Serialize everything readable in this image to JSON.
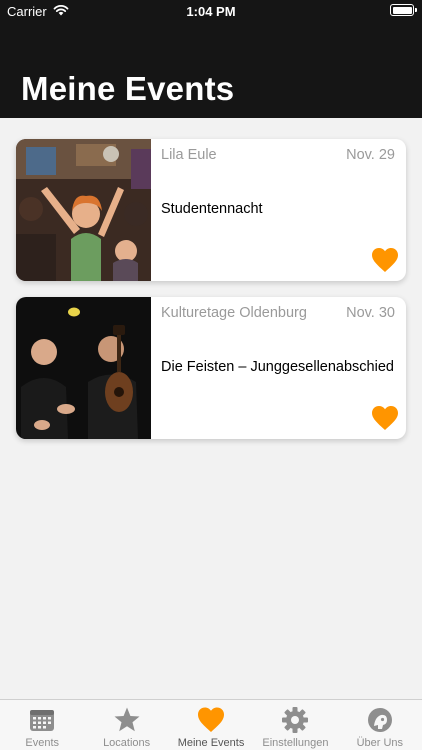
{
  "status_bar": {
    "carrier": "Carrier",
    "time": "1:04 PM"
  },
  "header": {
    "title": "Meine Events"
  },
  "events": [
    {
      "location": "Lila Eule",
      "date": "Nov. 29",
      "title": "Studentennacht",
      "favorite": true
    },
    {
      "location": "Kulturetage Oldenburg",
      "date": "Nov. 30",
      "title": "Die Feisten – Junggesellenabschied",
      "favorite": true
    }
  ],
  "tabbar": {
    "items": [
      {
        "label": "Events",
        "icon": "calendar-icon"
      },
      {
        "label": "Locations",
        "icon": "star-icon"
      },
      {
        "label": "Meine Events",
        "icon": "heart-icon",
        "active": true
      },
      {
        "label": "Einstellungen",
        "icon": "gear-icon"
      },
      {
        "label": "Über Uns",
        "icon": "about-icon"
      }
    ]
  },
  "colors": {
    "accent": "#FF9500",
    "header_bg": "#151515",
    "inactive": "#8e8e8e"
  }
}
